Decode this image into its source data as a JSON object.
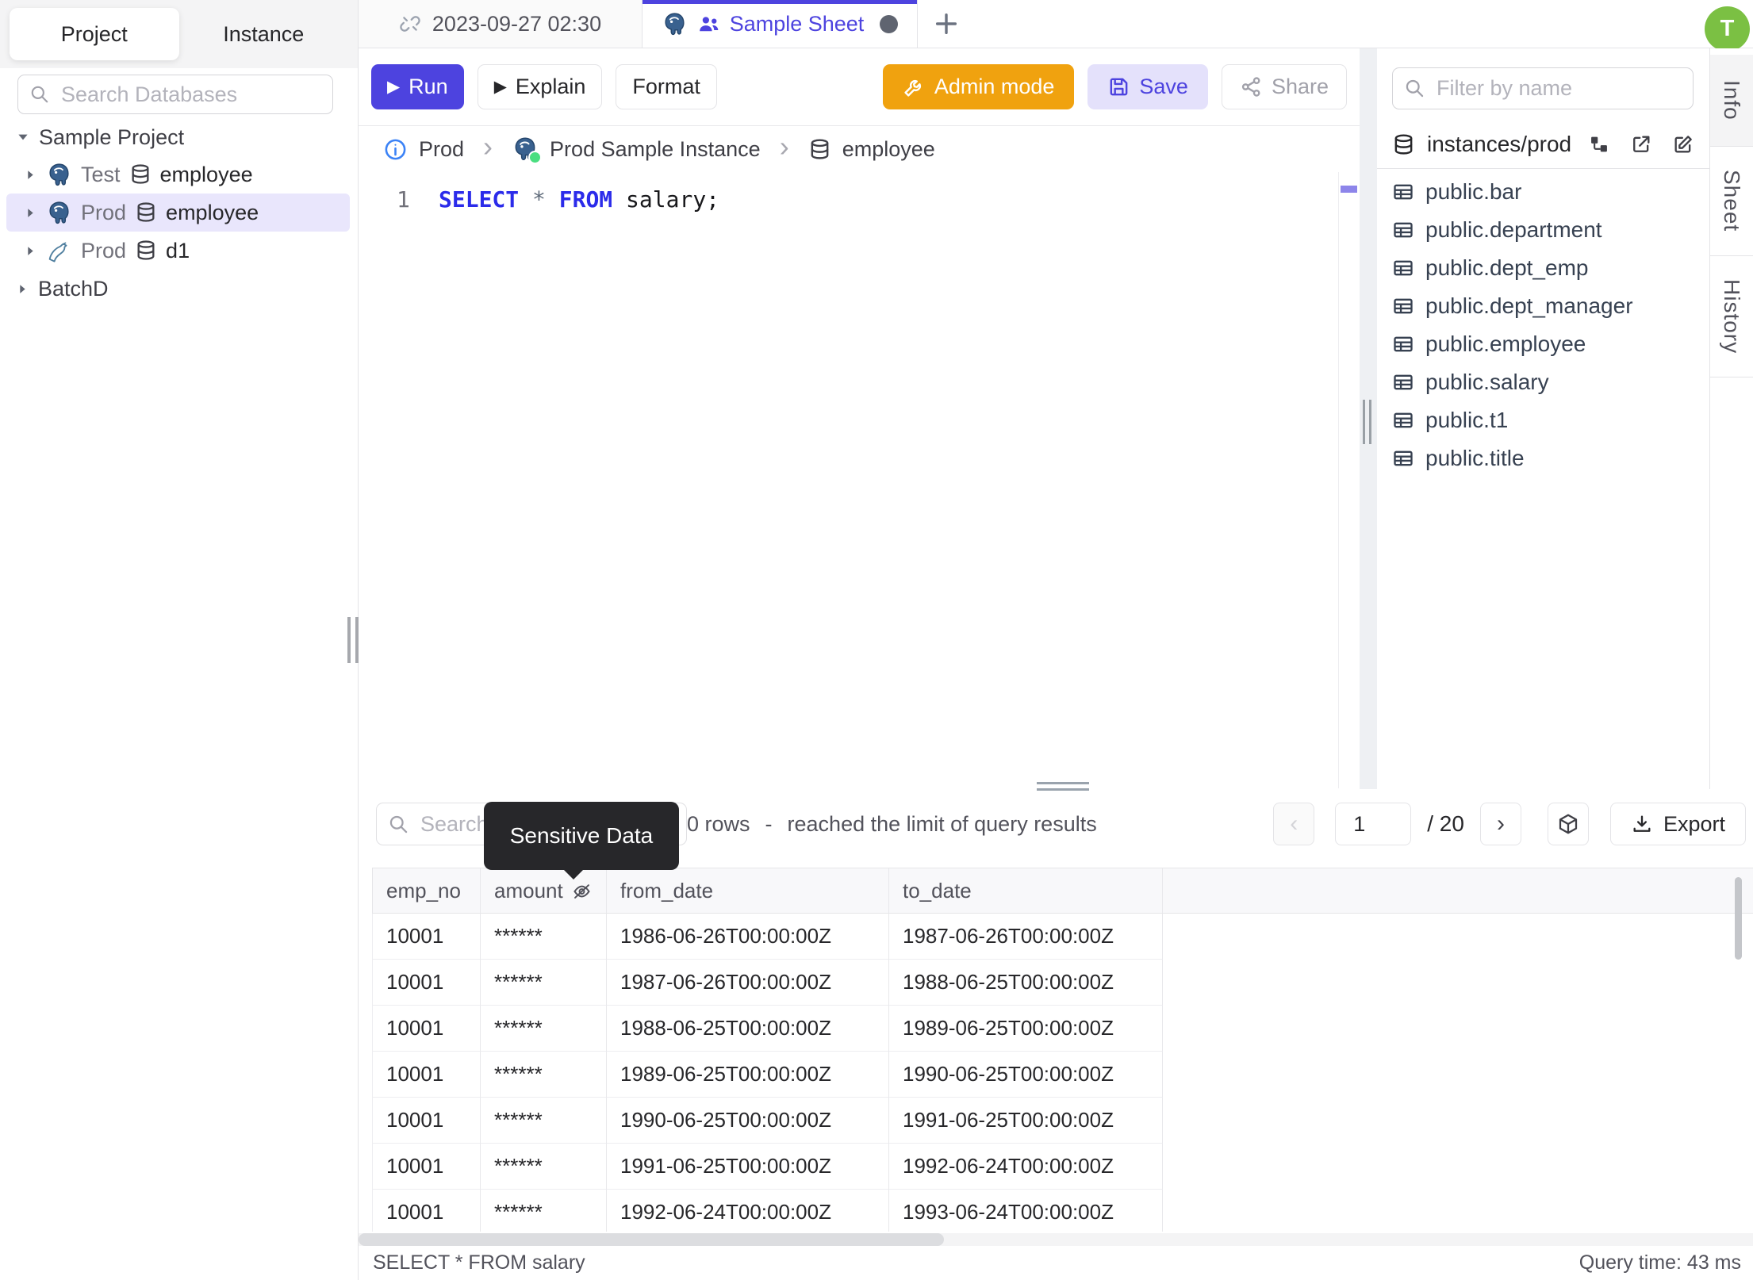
{
  "left_sidebar": {
    "tabs": [
      "Project",
      "Instance"
    ],
    "search_placeholder": "Search Databases",
    "tree": {
      "project": "Sample Project",
      "items": [
        {
          "env": "Test",
          "db": "employee",
          "engine": "postgres"
        },
        {
          "env": "Prod",
          "db": "employee",
          "engine": "postgres"
        },
        {
          "env": "Prod",
          "db": "d1",
          "engine": "mysql"
        }
      ],
      "batch": "BatchD"
    }
  },
  "tabbar": {
    "tab1_label": "2023-09-27 02:30",
    "tab2_label": "Sample Sheet",
    "plus_label": "+",
    "avatar_initial": "T"
  },
  "toolbar": {
    "run_label": "Run",
    "explain_label": "Explain",
    "format_label": "Format",
    "admin_label": "Admin mode",
    "save_label": "Save",
    "share_label": "Share"
  },
  "breadcrumb": {
    "env": "Prod",
    "instance": "Prod Sample Instance",
    "database": "employee"
  },
  "editor": {
    "line_number": "1",
    "keyword_select": "SELECT",
    "star": "*",
    "keyword_from": "FROM",
    "identifier": " salary;"
  },
  "right_panel": {
    "filter_placeholder": "Filter by name",
    "schema_path": "instances/prod",
    "tables": [
      "public.bar",
      "public.department",
      "public.dept_emp",
      "public.dept_manager",
      "public.employee",
      "public.salary",
      "public.t1",
      "public.title"
    ]
  },
  "side_tabs": [
    "Info",
    "Sheet",
    "History"
  ],
  "results": {
    "search_placeholder": "Search",
    "tooltip": "Sensitive Data",
    "row_count": "0 rows",
    "dash": "-",
    "limit_note": "reached the limit of query results",
    "page_current": "1",
    "page_total": "/ 20",
    "prev_glyph": "‹",
    "next_glyph": "›",
    "export_label": "Export",
    "columns": [
      "emp_no",
      "amount",
      "from_date",
      "to_date"
    ],
    "rows": [
      [
        "10001",
        "******",
        "1986-06-26T00:00:00Z",
        "1987-06-26T00:00:00Z"
      ],
      [
        "10001",
        "******",
        "1987-06-26T00:00:00Z",
        "1988-06-25T00:00:00Z"
      ],
      [
        "10001",
        "******",
        "1988-06-25T00:00:00Z",
        "1989-06-25T00:00:00Z"
      ],
      [
        "10001",
        "******",
        "1989-06-25T00:00:00Z",
        "1990-06-25T00:00:00Z"
      ],
      [
        "10001",
        "******",
        "1990-06-25T00:00:00Z",
        "1991-06-25T00:00:00Z"
      ],
      [
        "10001",
        "******",
        "1991-06-25T00:00:00Z",
        "1992-06-24T00:00:00Z"
      ],
      [
        "10001",
        "******",
        "1992-06-24T00:00:00Z",
        "1993-06-24T00:00:00Z"
      ]
    ],
    "status_query": "SELECT * FROM salary",
    "status_time": "Query time: 43 ms"
  },
  "icons": {
    "tab1_icon": "unlink-icon",
    "tab2_icons": [
      "postgres-icon",
      "users-icon"
    ],
    "amount_header_icon": "eye-off-icon"
  },
  "colors": {
    "accent_indigo": "#4d43df",
    "admin_orange": "#f0a20f",
    "avatar_green": "#7bc043",
    "keyword_blue": "#2b2bea",
    "tooltip_bg": "#27272a",
    "selected_tree_row_bg": "#e9e6fc",
    "status_dot_green": "#4ade80"
  }
}
